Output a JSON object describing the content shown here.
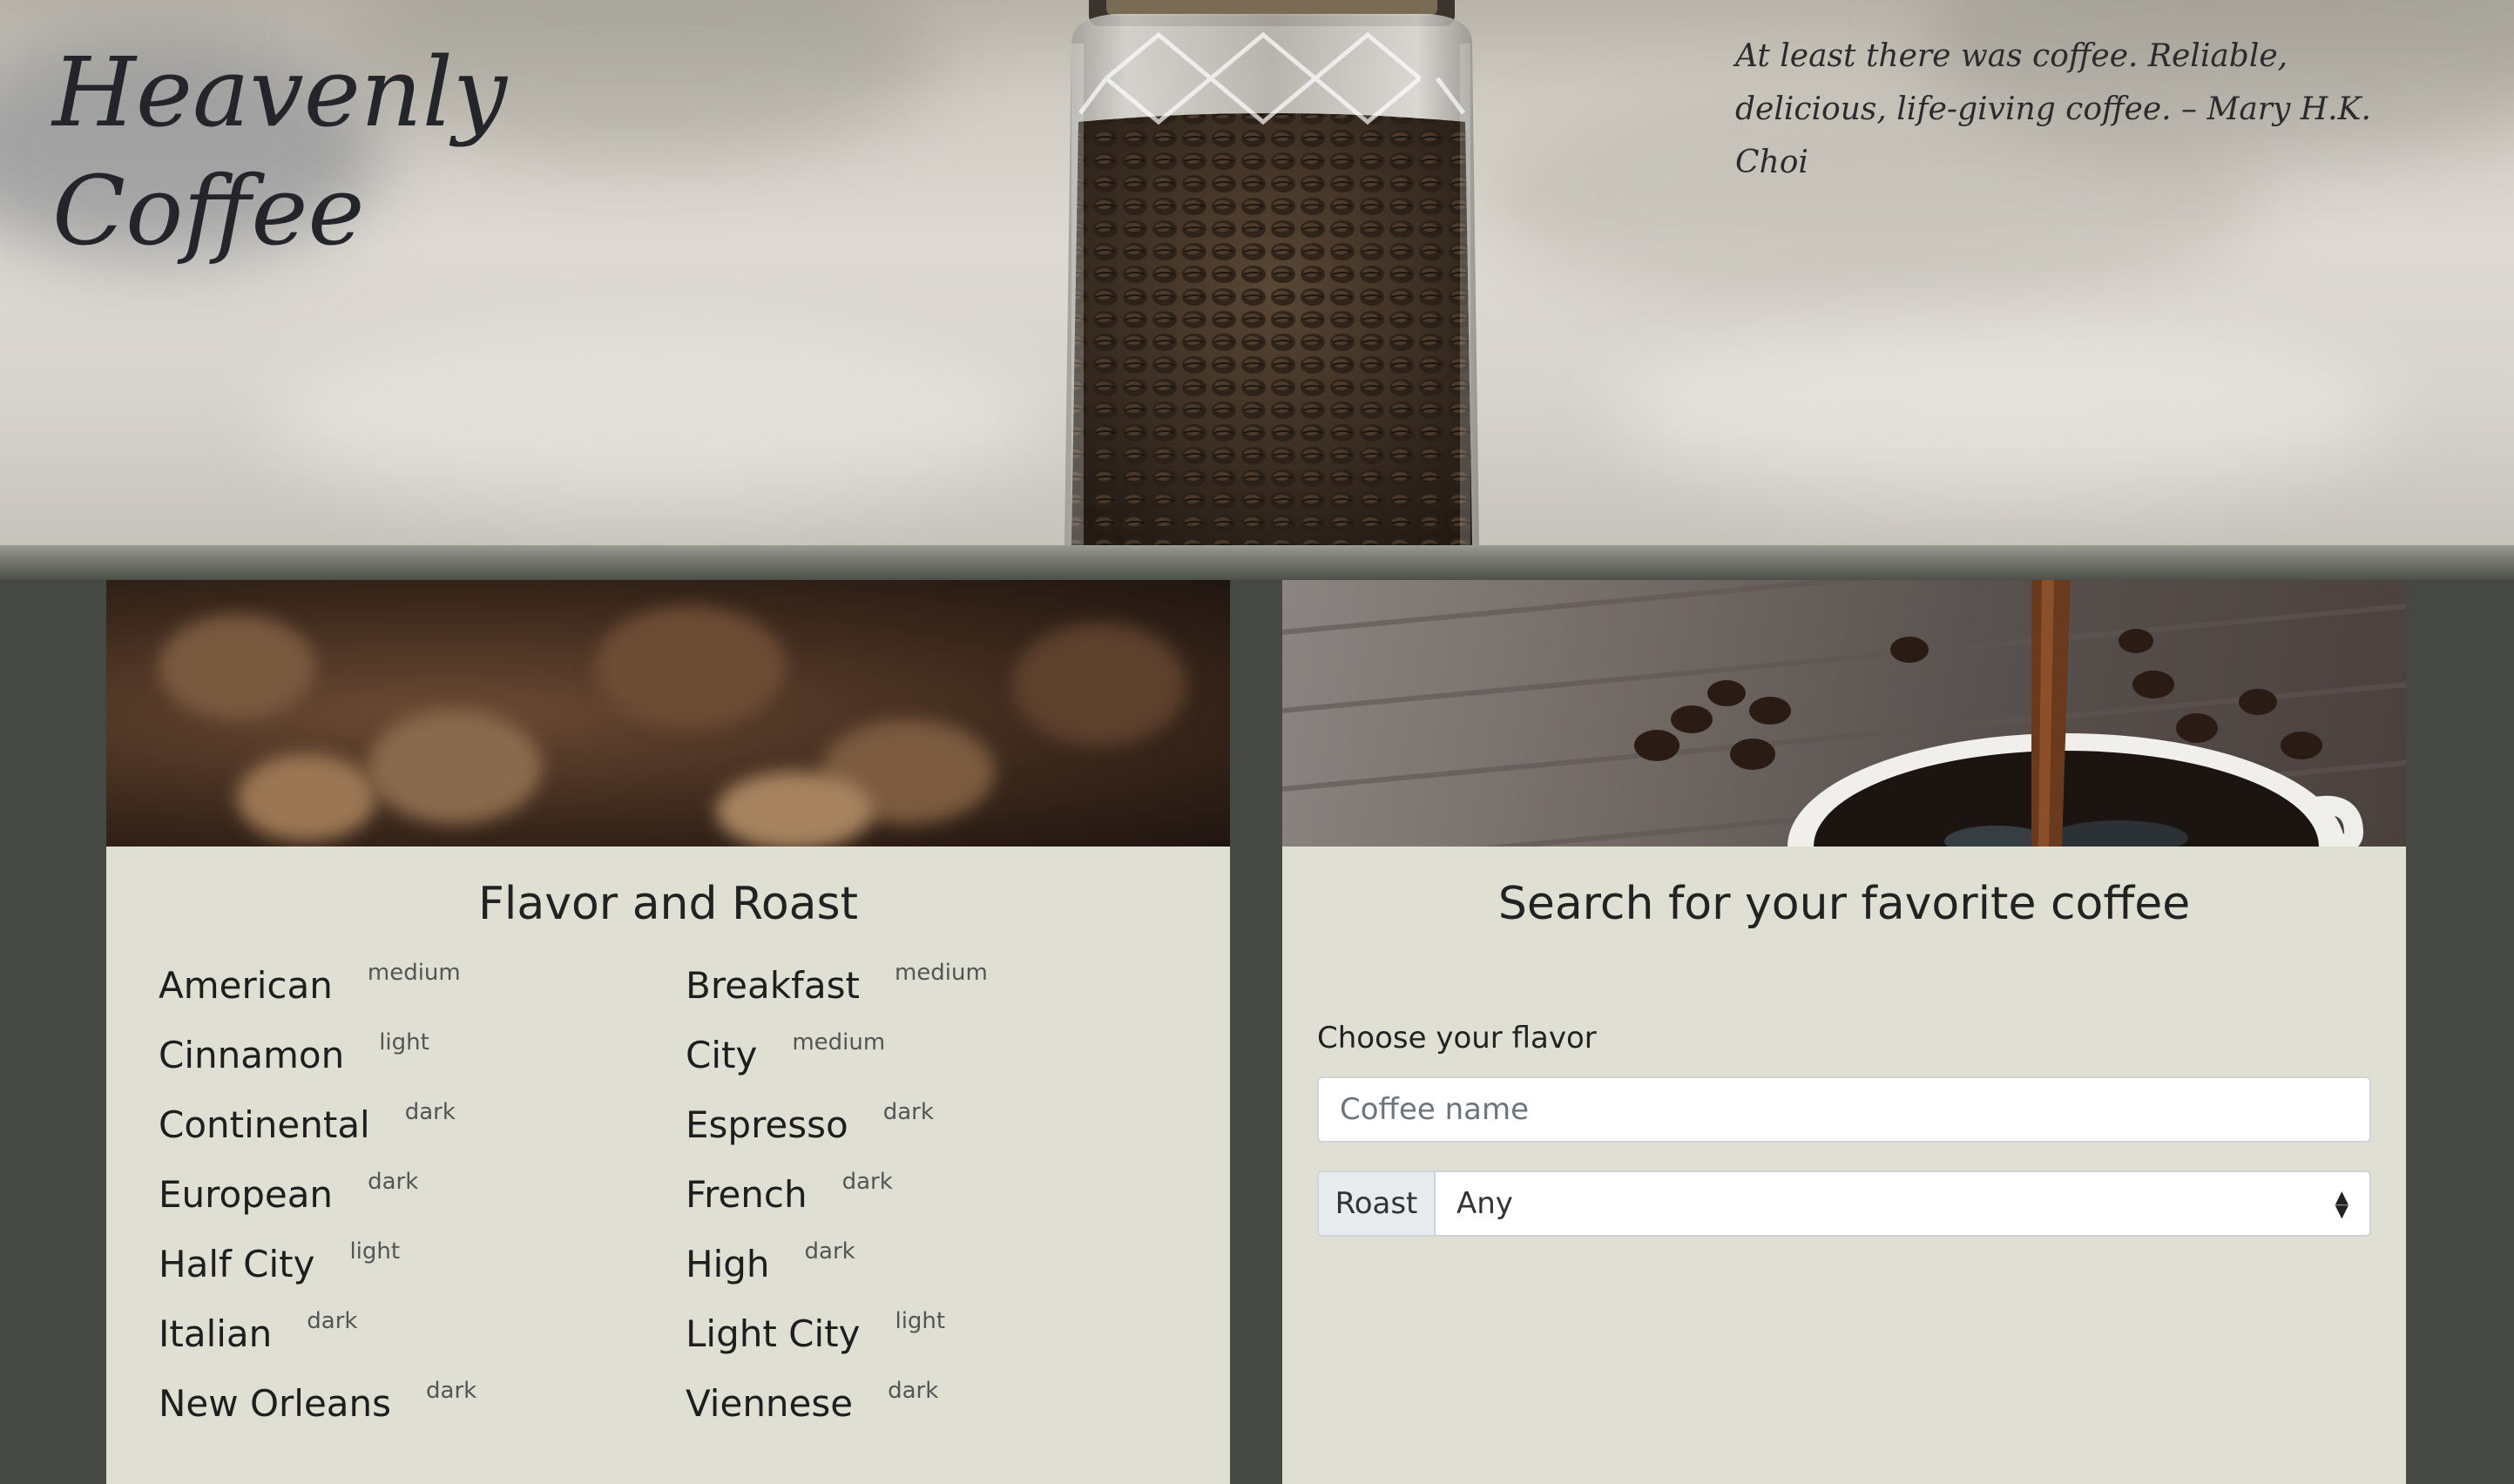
{
  "header": {
    "title_line1": "Heavenly",
    "title_line2": "Coffee",
    "quote": "At least there was coffee. Reliable, delicious, life-giving coffee. – Mary H.K. Choi"
  },
  "flavor_card": {
    "title": "Flavor and Roast",
    "items": [
      {
        "name": "American",
        "roast": "medium"
      },
      {
        "name": "Breakfast",
        "roast": "medium"
      },
      {
        "name": "Cinnamon",
        "roast": "light"
      },
      {
        "name": "City",
        "roast": "medium"
      },
      {
        "name": "Continental",
        "roast": "dark"
      },
      {
        "name": "Espresso",
        "roast": "dark"
      },
      {
        "name": "European",
        "roast": "dark"
      },
      {
        "name": "French",
        "roast": "dark"
      },
      {
        "name": "Half City",
        "roast": "light"
      },
      {
        "name": "High",
        "roast": "dark"
      },
      {
        "name": "Italian",
        "roast": "dark"
      },
      {
        "name": "Light City",
        "roast": "light"
      },
      {
        "name": "New Orleans",
        "roast": "dark"
      },
      {
        "name": "Viennese",
        "roast": "dark"
      }
    ]
  },
  "search_card": {
    "title": "Search for your favorite coffee",
    "flavor_label": "Choose your flavor",
    "flavor_placeholder": "Coffee name",
    "roast_label": "Roast",
    "roast_selected": "Any",
    "caret_up": "▲",
    "caret_down": "▼"
  },
  "colors": {
    "page_background": "#464843",
    "card_background": "#dfdfd3"
  }
}
